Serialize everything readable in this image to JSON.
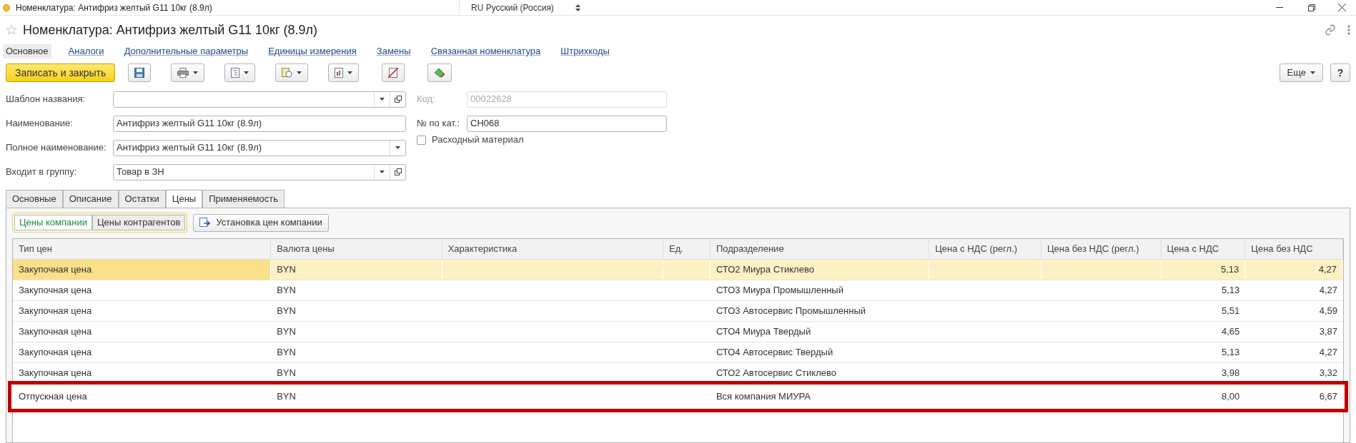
{
  "window": {
    "title": "Номенклатура: Антифриз желтый G11 10кг (8.9л)",
    "language": "RU Русский (Россия)"
  },
  "header": {
    "title": "Номенклатура: Антифриз желтый G11 10кг (8.9л)"
  },
  "nav": [
    {
      "label": "Основное",
      "selected": true
    },
    {
      "label": "Аналоги",
      "selected": false
    },
    {
      "label": "Дополнительные параметры",
      "selected": false
    },
    {
      "label": "Единицы измерения",
      "selected": false
    },
    {
      "label": "Замены",
      "selected": false
    },
    {
      "label": "Связанная номенклатура",
      "selected": false
    },
    {
      "label": "Штрихкоды",
      "selected": false
    }
  ],
  "toolbar": {
    "primary": "Записать и закрыть",
    "more": "Еще",
    "help": "?"
  },
  "fields_left": [
    {
      "label": "Шаблон названия:",
      "dropdown": true,
      "open": true
    },
    {
      "label": "Наименование:",
      "value": "Антифриз желтый G11 10кг (8.9л)",
      "dropdown": false,
      "open": false
    },
    {
      "label": "Полное наименование:",
      "value": "Антифриз желтый G11 10кг (8.9л)",
      "dropdown": true,
      "open": false
    },
    {
      "label": "Входит в группу:",
      "value": "Товар в ЗН",
      "dropdown": true,
      "open": true
    }
  ],
  "fields_right": [
    {
      "label": "Код:",
      "value": "00022628",
      "disabled": true
    },
    {
      "label": "№ по кат.:",
      "value": "CH068",
      "disabled": false
    }
  ],
  "checkbox": {
    "label": "Расходный материал",
    "checked": false
  },
  "tabs": [
    {
      "label": "Основные",
      "selected": false
    },
    {
      "label": "Описание",
      "selected": false
    },
    {
      "label": "Остатки",
      "selected": false
    },
    {
      "label": "Цены",
      "selected": true
    },
    {
      "label": "Применяемость",
      "selected": false
    }
  ],
  "price_switch": [
    {
      "label": "Цены компании",
      "selected": true
    },
    {
      "label": "Цены контрагентов",
      "selected": false
    }
  ],
  "set_prices_button": "Установка цен компании",
  "table": {
    "columns": [
      "Тип цен",
      "Валюта цены",
      "Характеристика",
      "Ед.",
      "Подразделение",
      "Цена с НДС (регл.)",
      "Цена без НДС (регл.)",
      "Цена с НДС",
      "Цена без НДС"
    ],
    "rows": [
      {
        "cells": [
          "Закупочная цена",
          "BYN",
          "",
          "",
          "СТО2 Миура Стиклево",
          "",
          "",
          "5,13",
          "4,27"
        ],
        "selected": true,
        "highlighted": false
      },
      {
        "cells": [
          "Закупочная цена",
          "BYN",
          "",
          "",
          "СТО3 Миура Промышленный",
          "",
          "",
          "5,13",
          "4,27"
        ],
        "selected": false,
        "highlighted": false
      },
      {
        "cells": [
          "Закупочная цена",
          "BYN",
          "",
          "",
          "СТО3 Автосервис Промышленный",
          "",
          "",
          "5,51",
          "4,59"
        ],
        "selected": false,
        "highlighted": false
      },
      {
        "cells": [
          "Закупочная цена",
          "BYN",
          "",
          "",
          "СТО4 Миура Твердый",
          "",
          "",
          "4,65",
          "3,87"
        ],
        "selected": false,
        "highlighted": false
      },
      {
        "cells": [
          "Закупочная цена",
          "BYN",
          "",
          "",
          "СТО4 Автосервис Твердый",
          "",
          "",
          "5,13",
          "4,27"
        ],
        "selected": false,
        "highlighted": false
      },
      {
        "cells": [
          "Закупочная цена",
          "BYN",
          "",
          "",
          "СТО2 Автосервис Стиклево",
          "",
          "",
          "3,98",
          "3,32"
        ],
        "selected": false,
        "highlighted": false
      },
      {
        "cells": [
          "Отпускная цена",
          "BYN",
          "",
          "",
          "Вся компания МИУРА",
          "",
          "",
          "8,00",
          "6,67"
        ],
        "selected": false,
        "highlighted": true
      }
    ]
  }
}
